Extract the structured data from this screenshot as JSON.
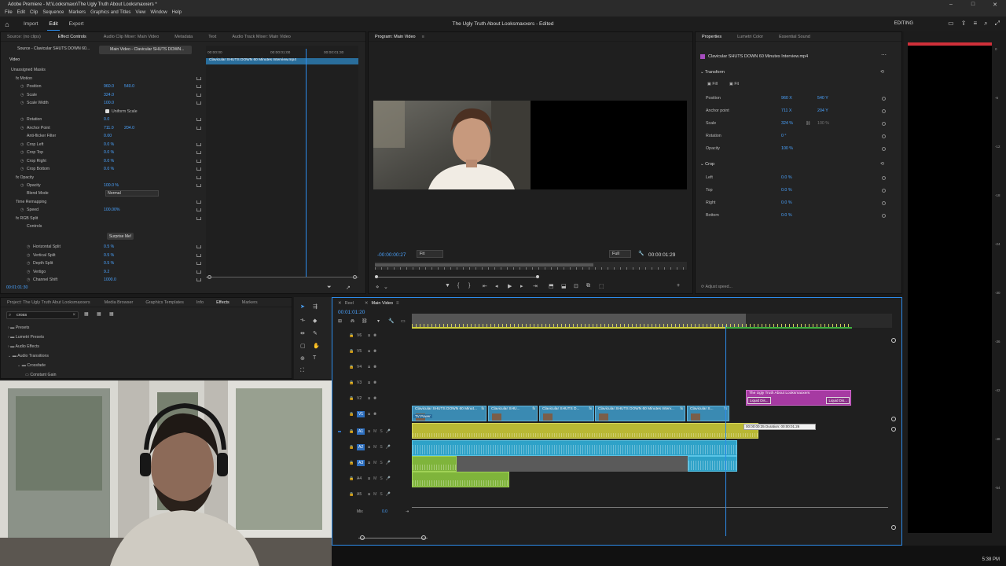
{
  "app": {
    "title": "Adobe Premiere - M:\\Looksmaxx\\The Ugly Truth About Looksmaxxers *",
    "window_controls": [
      "–",
      "□",
      "✕"
    ]
  },
  "menu": [
    "File",
    "Edit",
    "Clip",
    "Sequence",
    "Markers",
    "Graphics and Titles",
    "View",
    "Window",
    "Help"
  ],
  "topbar": {
    "tabs": [
      "Import",
      "Edit",
      "Export"
    ],
    "active_tab": "Edit",
    "doc_title": "The Ugly Truth About Looksmaxxers - Edited",
    "workspace": "EDITING"
  },
  "source_panel": {
    "tabs": [
      "Source: (no clips)",
      "Effect Controls",
      "Audio Clip Mixer: Main Video",
      "Metadata",
      "Text",
      "Audio Track Mixer: Main Video"
    ],
    "active_tab": "Effect Controls",
    "source_label": "Source - Clavicular SHUTS DOWN 60...",
    "seq_label": "Main Video - Clavicular SHUTS DOWN...",
    "timecodes": [
      "00:00:00",
      "00:00:01:00",
      "00:00:01:30"
    ],
    "clip_bar": "Clavicular SHUTS DOWN 60 Minutes Interview.mp4",
    "section": "Video",
    "rows": [
      {
        "name": "Unassigned Masks",
        "v1": "",
        "v2": ""
      },
      {
        "name": "fx Motion",
        "v1": "",
        "v2": ""
      },
      {
        "name": "Position",
        "v1": "960.0",
        "v2": "540.0"
      },
      {
        "name": "Scale",
        "v1": "324.0",
        "v2": ""
      },
      {
        "name": "Scale Width",
        "v1": "100.0",
        "v2": ""
      },
      {
        "name": "Uniform Scale",
        "v1": "",
        "v2": ""
      },
      {
        "name": "Rotation",
        "v1": "0.0",
        "v2": ""
      },
      {
        "name": "Anchor Point",
        "v1": "711.0",
        "v2": "204.0"
      },
      {
        "name": "Anti-flicker Filter",
        "v1": "0.00",
        "v2": ""
      },
      {
        "name": "Crop Left",
        "v1": "0.0 %",
        "v2": ""
      },
      {
        "name": "Crop Top",
        "v1": "0.0 %",
        "v2": ""
      },
      {
        "name": "Crop Right",
        "v1": "0.0 %",
        "v2": ""
      },
      {
        "name": "Crop Bottom",
        "v1": "0.0 %",
        "v2": ""
      },
      {
        "name": "fx Opacity",
        "v1": "",
        "v2": ""
      },
      {
        "name": "Opacity",
        "v1": "100.0 %",
        "v2": ""
      },
      {
        "name": "Blend Mode",
        "v1": "Normal",
        "v2": ""
      },
      {
        "name": "Time Remapping",
        "v1": "",
        "v2": ""
      },
      {
        "name": "Speed",
        "v1": "100.00%",
        "v2": ""
      },
      {
        "name": "fx RGB Split",
        "v1": "",
        "v2": ""
      },
      {
        "name": "Controls",
        "v1": "",
        "v2": ""
      },
      {
        "name": "Surprise Me!",
        "v1": "",
        "v2": ""
      },
      {
        "name": "Horizontal Split",
        "v1": "0.5 %",
        "v2": ""
      },
      {
        "name": "Vertical Split",
        "v1": "0.5 %",
        "v2": ""
      },
      {
        "name": "Depth Split",
        "v1": "0.5 %",
        "v2": ""
      },
      {
        "name": "Vertigo",
        "v1": "9.2",
        "v2": ""
      },
      {
        "name": "Channel Shift",
        "v1": "1000.0",
        "v2": ""
      }
    ],
    "timecode_bottom": "00:01:01:30"
  },
  "program_monitor": {
    "title": "Program: Main Video",
    "current_time": "-00:00:00:27",
    "fit": "Fit",
    "quality": "Full",
    "duration": "00:00:01:29",
    "progress": 0.7
  },
  "properties": {
    "tabs": [
      "Properties",
      "Lumetri Color",
      "Essential Sound"
    ],
    "active_tab": "Properties",
    "clip_name": "Clavicular SHUTS DOWN 60 Minutes Interview.mp4",
    "transform_title": "Transform",
    "fill": "Fill",
    "fit": "Fit",
    "rows": [
      {
        "name": "Position",
        "v1": "960 X",
        "v2": "540 Y"
      },
      {
        "name": "Anchor point",
        "v1": "711 X",
        "v2": "204 Y"
      },
      {
        "name": "Scale",
        "v1": "324 %",
        "v2": "100 %"
      },
      {
        "name": "Rotation",
        "v1": "0 °",
        "v2": ""
      },
      {
        "name": "Opacity",
        "v1": "100 %",
        "v2": ""
      }
    ],
    "crop_title": "Crop",
    "crop_rows": [
      {
        "name": "Left",
        "v1": "0.0 %"
      },
      {
        "name": "Top",
        "v1": "0.0 %"
      },
      {
        "name": "Right",
        "v1": "0.0 %"
      },
      {
        "name": "Bottom",
        "v1": "0.0 %"
      }
    ],
    "adjust_speed": "Adjust speed..."
  },
  "project_panel": {
    "tabs": [
      "Project: The Ugly Truth Abut Looksmaxxers",
      "Media Browser",
      "Graphics Templates",
      "Info",
      "Effects",
      "Markers"
    ],
    "active_tab": "Effects",
    "search_value": "cross",
    "tree": [
      {
        "label": "Presets"
      },
      {
        "label": "Lumetri Presets"
      },
      {
        "label": "Audio Effects"
      },
      {
        "label": "Audio Transitions"
      },
      {
        "label": "Crossfade"
      },
      {
        "label": "Constant Gain"
      }
    ]
  },
  "timeline": {
    "tabs": [
      "Reel",
      "Main Video"
    ],
    "active_tab": "Main Video",
    "timecode": "00:01:01:20",
    "tracks_video": [
      "V6",
      "V5",
      "V4",
      "V3",
      "V2",
      "V1"
    ],
    "tracks_audio": [
      "A1",
      "A2",
      "A3",
      "A4",
      "A5"
    ],
    "mix_label": "Mix",
    "mix_value": "0.0",
    "clips_v1": [
      "Clavicular SHUTS DOWN 60 Minut...",
      "Clavicular SHU...",
      "Clavicular SHUTS D...",
      "Clavicular SHUTS DOWN 60 Minutes Interv...",
      "Clavicular S..."
    ],
    "title_clip": "The Ugly Truth About Looksmaxxers",
    "liquid_label": "Liquid Dis...",
    "tv_power": "TV Power",
    "tooltip": "00:00:00:35 Duration: 00:00:01:26"
  },
  "meter_scale": [
    "0",
    "-6",
    "-12",
    "-18",
    "-24",
    "-30",
    "-36",
    "-42",
    "-48",
    "-54"
  ],
  "taskbar_time": "5:38 PM"
}
